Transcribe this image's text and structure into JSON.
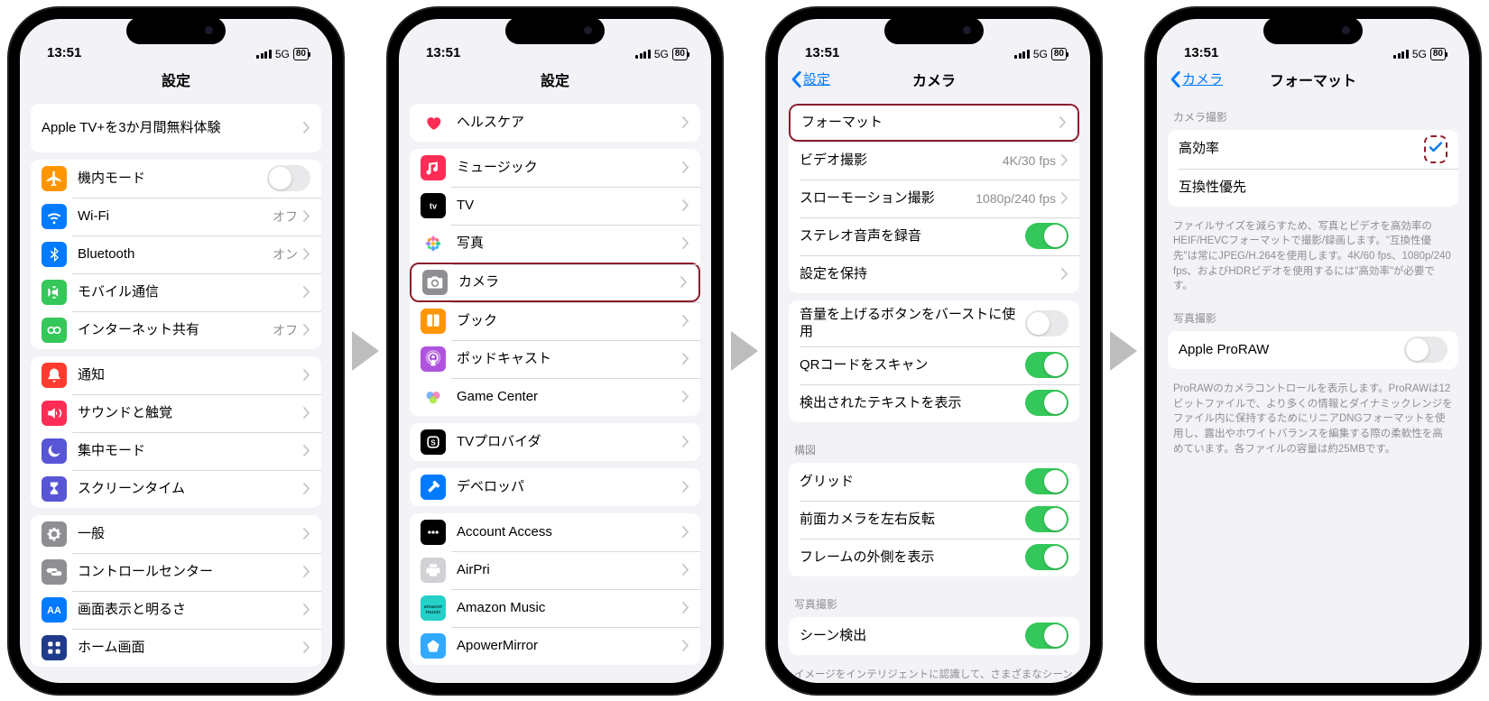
{
  "status": {
    "time": "13:51",
    "net": "5G",
    "battery": "80"
  },
  "phone1": {
    "title": "設定",
    "promo": "Apple TV+を3か月間無料体験",
    "g1": [
      {
        "icon": "airplane",
        "bg": "#ff9500",
        "label": "機内モード",
        "type": "toggle",
        "on": false
      },
      {
        "icon": "wifi",
        "bg": "#007aff",
        "label": "Wi-Fi",
        "value": "オフ"
      },
      {
        "icon": "bluetooth",
        "bg": "#007aff",
        "label": "Bluetooth",
        "value": "オン"
      },
      {
        "icon": "cellular",
        "bg": "#34c759",
        "label": "モバイル通信"
      },
      {
        "icon": "hotspot",
        "bg": "#34c759",
        "label": "インターネット共有",
        "value": "オフ"
      }
    ],
    "g2": [
      {
        "icon": "bell",
        "bg": "#ff3b30",
        "label": "通知"
      },
      {
        "icon": "sound",
        "bg": "#ff2d55",
        "label": "サウンドと触覚"
      },
      {
        "icon": "moon",
        "bg": "#5856d6",
        "label": "集中モード"
      },
      {
        "icon": "hourglass",
        "bg": "#5856d6",
        "label": "スクリーンタイム"
      }
    ],
    "g3": [
      {
        "icon": "gear",
        "bg": "#8e8e93",
        "label": "一般"
      },
      {
        "icon": "switches",
        "bg": "#8e8e93",
        "label": "コントロールセンター"
      },
      {
        "icon": "aa",
        "bg": "#007aff",
        "label": "画面表示と明るさ"
      },
      {
        "icon": "grid",
        "bg": "#1e3a8a",
        "label": "ホーム画面"
      }
    ]
  },
  "phone2": {
    "title": "設定",
    "g1": [
      {
        "icon": "heart",
        "bg": "#fff",
        "fg": "#ff2d55",
        "label": "ヘルスケア"
      }
    ],
    "g2": [
      {
        "icon": "music",
        "bg": "#ff2d55",
        "label": "ミュージック"
      },
      {
        "icon": "tv",
        "bg": "#000",
        "label": "TV"
      },
      {
        "icon": "flower",
        "bg": "#fff",
        "label": "写真"
      },
      {
        "icon": "camera",
        "bg": "#8e8e93",
        "label": "カメラ",
        "hilite": true
      },
      {
        "icon": "book",
        "bg": "#ff9500",
        "label": "ブック"
      },
      {
        "icon": "podcast",
        "bg": "#af52de",
        "label": "ポッドキャスト"
      },
      {
        "icon": "gamecenter",
        "bg": "#fff",
        "label": "Game Center"
      }
    ],
    "g3": [
      {
        "icon": "sbox",
        "bg": "#000",
        "label": "TVプロバイダ"
      }
    ],
    "g4": [
      {
        "icon": "hammer",
        "bg": "#007aff",
        "label": "デベロッパ"
      }
    ],
    "g5": [
      {
        "icon": "dots",
        "bg": "#000",
        "label": "Account Access"
      },
      {
        "icon": "printer",
        "bg": "#d1d1d6",
        "label": "AirPri"
      },
      {
        "icon": "am",
        "bg": "#25d0c9",
        "label": "Amazon Music"
      },
      {
        "icon": "ap",
        "bg": "#33a8ff",
        "label": "ApowerMirror"
      }
    ]
  },
  "phone3": {
    "back": "設定",
    "title": "カメラ",
    "g1": [
      {
        "label": "フォーマット",
        "type": "nav",
        "hilite": true
      },
      {
        "label": "ビデオ撮影",
        "value": "4K/30 fps",
        "type": "nav"
      },
      {
        "label": "スローモーション撮影",
        "value": "1080p/240 fps",
        "type": "nav"
      },
      {
        "label": "ステレオ音声を録音",
        "type": "toggle",
        "on": true
      },
      {
        "label": "設定を保持",
        "type": "nav"
      }
    ],
    "g2": [
      {
        "label": "音量を上げるボタンをバーストに使用",
        "type": "toggle",
        "on": false
      },
      {
        "label": "QRコードをスキャン",
        "type": "toggle",
        "on": true
      },
      {
        "label": "検出されたテキストを表示",
        "type": "toggle",
        "on": true
      }
    ],
    "h3": "構図",
    "g3": [
      {
        "label": "グリッド",
        "type": "toggle",
        "on": true
      },
      {
        "label": "前面カメラを左右反転",
        "type": "toggle",
        "on": true
      },
      {
        "label": "フレームの外側を表示",
        "type": "toggle",
        "on": true
      }
    ],
    "h4": "写真撮影",
    "g4": [
      {
        "label": "シーン検出",
        "type": "toggle",
        "on": true
      }
    ],
    "f4": "イメージをインテリジェントに認識して、さまざまなシーンの写真をより美しくします。"
  },
  "phone4": {
    "back": "カメラ",
    "title": "フォーマット",
    "h1": "カメラ撮影",
    "g1": [
      {
        "label": "高効率",
        "type": "check",
        "checked": true,
        "hilite": "dashed"
      },
      {
        "label": "互換性優先",
        "type": "plain"
      }
    ],
    "f1": "ファイルサイズを減らすため、写真とビデオを高効率のHEIF/HEVCフォーマットで撮影/録画します。\"互換性優先\"は常にJPEG/H.264を使用します。4K/60 fps、1080p/240 fps、およびHDRビデオを使用するには\"高効率\"が必要です。",
    "h2": "写真撮影",
    "g2": [
      {
        "label": "Apple ProRAW",
        "type": "toggle",
        "on": false
      }
    ],
    "f2": "ProRAWのカメラコントロールを表示します。ProRAWは12ビットファイルで、より多くの情報とダイナミックレンジをファイル内に保持するためにリニアDNGフォーマットを使用し、露出やホワイトバランスを編集する際の柔軟性を高めています。各ファイルの容量は約25MBです。"
  }
}
